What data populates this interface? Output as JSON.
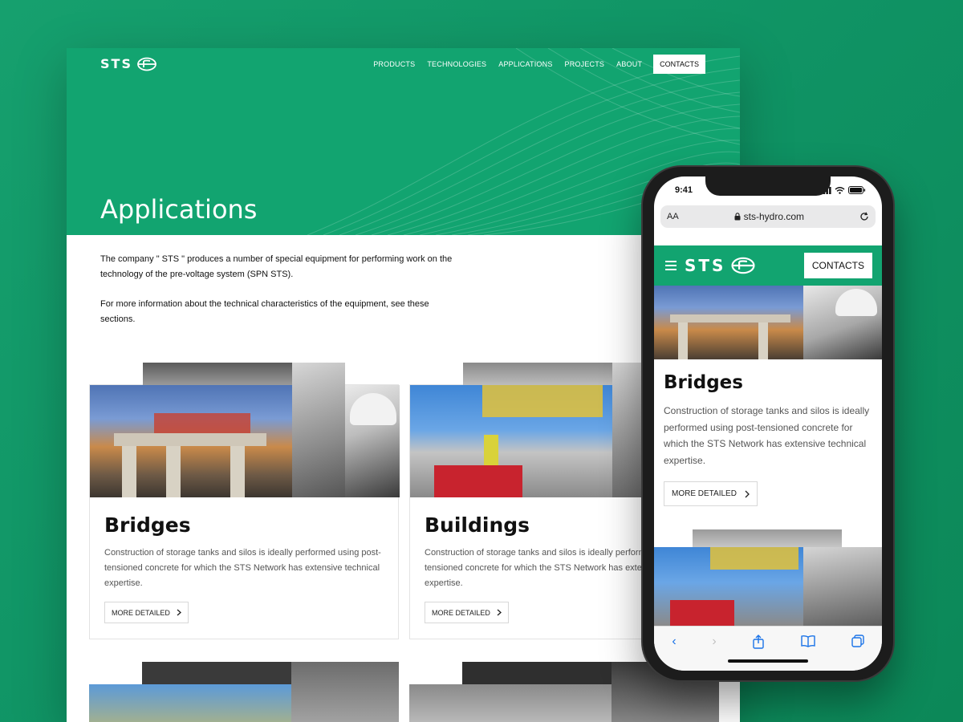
{
  "desktop": {
    "logo_text": "STS",
    "nav": [
      "PRODUCTS",
      "TECHNOLOGIES",
      "APPLICATIONS",
      "PROJECTS",
      "ABOUT"
    ],
    "contacts_label": "CONTACTS",
    "page_title": "Applications",
    "intro_p1": "The company \" STS \" produces a number of special equipment for performing work on the technology of the pre-voltage system (SPN STS).",
    "intro_p2": "For more information about the technical characteristics of the equipment, see these sections.",
    "cards": [
      {
        "title": "Bridges",
        "text": "Construction of storage tanks and silos is ideally performed using post-tensioned concrete for which the STS Network has extensive technical expertise.",
        "button": "MORE DETAILED"
      },
      {
        "title": "Buildings",
        "text": "Construction of storage tanks and silos is ideally performed using post-tensioned concrete for which the STS Network has extensive technical expertise.",
        "button": "MORE DETAILED"
      }
    ]
  },
  "phone": {
    "time": "9:41",
    "aa": "AA",
    "url": "sts-hydro.com",
    "logo_text": "STS",
    "contacts_label": "CONTACTS",
    "card_title": "Bridges",
    "card_text": "Construction of storage tanks and silos is ideally performed using post-tensioned concrete for which the STS Network has extensive technical expertise.",
    "button": "MORE DETAILED"
  },
  "colors": {
    "brand_green": "#12a470",
    "background_green": "#0f9263",
    "link_blue": "#1a73e8"
  },
  "icons": [
    "sts-logo-icon",
    "chevron-right-icon",
    "lock-icon",
    "reload-icon",
    "hamburger-icon",
    "back-icon",
    "forward-icon",
    "share-icon",
    "bookmarks-icon",
    "tabs-icon",
    "signal-icon",
    "wifi-icon",
    "battery-icon"
  ]
}
